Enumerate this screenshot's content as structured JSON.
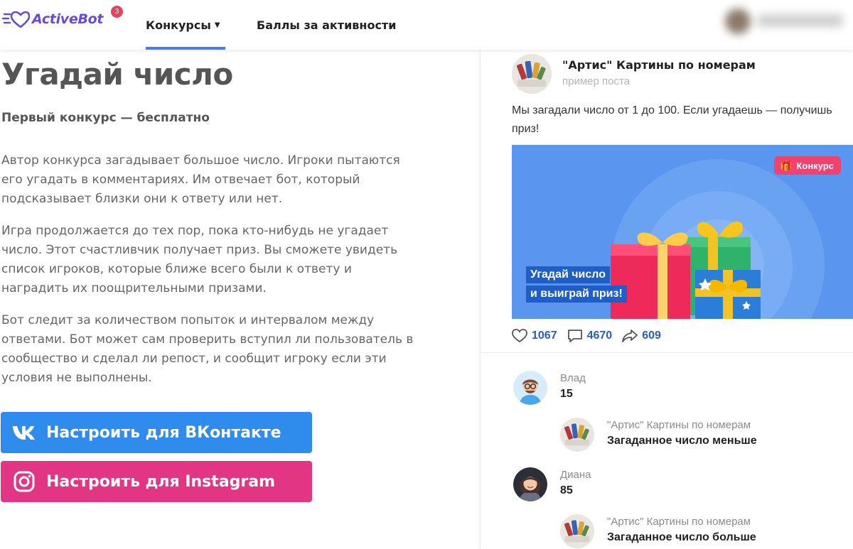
{
  "header": {
    "logo_text": "ActiveBot",
    "logo_badge": "3",
    "nav": {
      "contests": "Конкурсы",
      "points": "Баллы за активности"
    }
  },
  "main": {
    "title": "Угадай число",
    "subtitle": "Первый конкурс — бесплатно",
    "paragraphs": [
      "Автор конкурса загадывает большое число. Игроки пытаются его угадать в комментариях. Им отвечает бот, который подсказывает близки они к ответу или нет.",
      "Игра продолжается до тех пор, пока кто-нибудь не угадает число. Этот счастливчик получает приз. Вы сможете увидеть список игроков, которые ближе всего были к ответу и наградить их поощрительными призами.",
      "Бот следит за количеством попыток и интервалом между ответами. Бот может сам проверить вступил ли пользователь в сообщество и сделал ли репост, и сообщит игроку если эти условия не выполнены."
    ],
    "buttons": {
      "vk": "Настроить для ВКонтакте",
      "instagram": "Настроить для Instagram"
    }
  },
  "post": {
    "author": "\"Артис\" Картины по номерам",
    "sub": "пример поста",
    "text": "Мы загадали число от 1 до 100. Если угадаешь — получишь приз!",
    "banner": {
      "badge": "Конкурс",
      "line1": "Угадай число",
      "line2": "и выиграй приз!"
    },
    "stats": {
      "likes": "1067",
      "comments": "4670",
      "shares": "609"
    },
    "comments": [
      {
        "name": "Влад",
        "text": "15"
      },
      {
        "name": "\"Артис\" Картины по номерам",
        "text": "Загаданное число меньше"
      },
      {
        "name": "Диана",
        "text": "85"
      },
      {
        "name": "\"Артис\" Картины по номерам",
        "text": "Загаданное число больше"
      }
    ]
  },
  "colors": {
    "accent": "#4a7de0",
    "vk_button": "#2f8cec",
    "instagram_button": "#e23584",
    "logo": "#6a4bd6",
    "stat_text": "#2a5cc4",
    "banner_bg": "#5a96ef"
  },
  "icons": [
    "heart-logo-icon",
    "caret-down-icon",
    "vk-icon",
    "instagram-icon",
    "gift-icon",
    "like-icon",
    "comment-icon",
    "share-icon"
  ]
}
